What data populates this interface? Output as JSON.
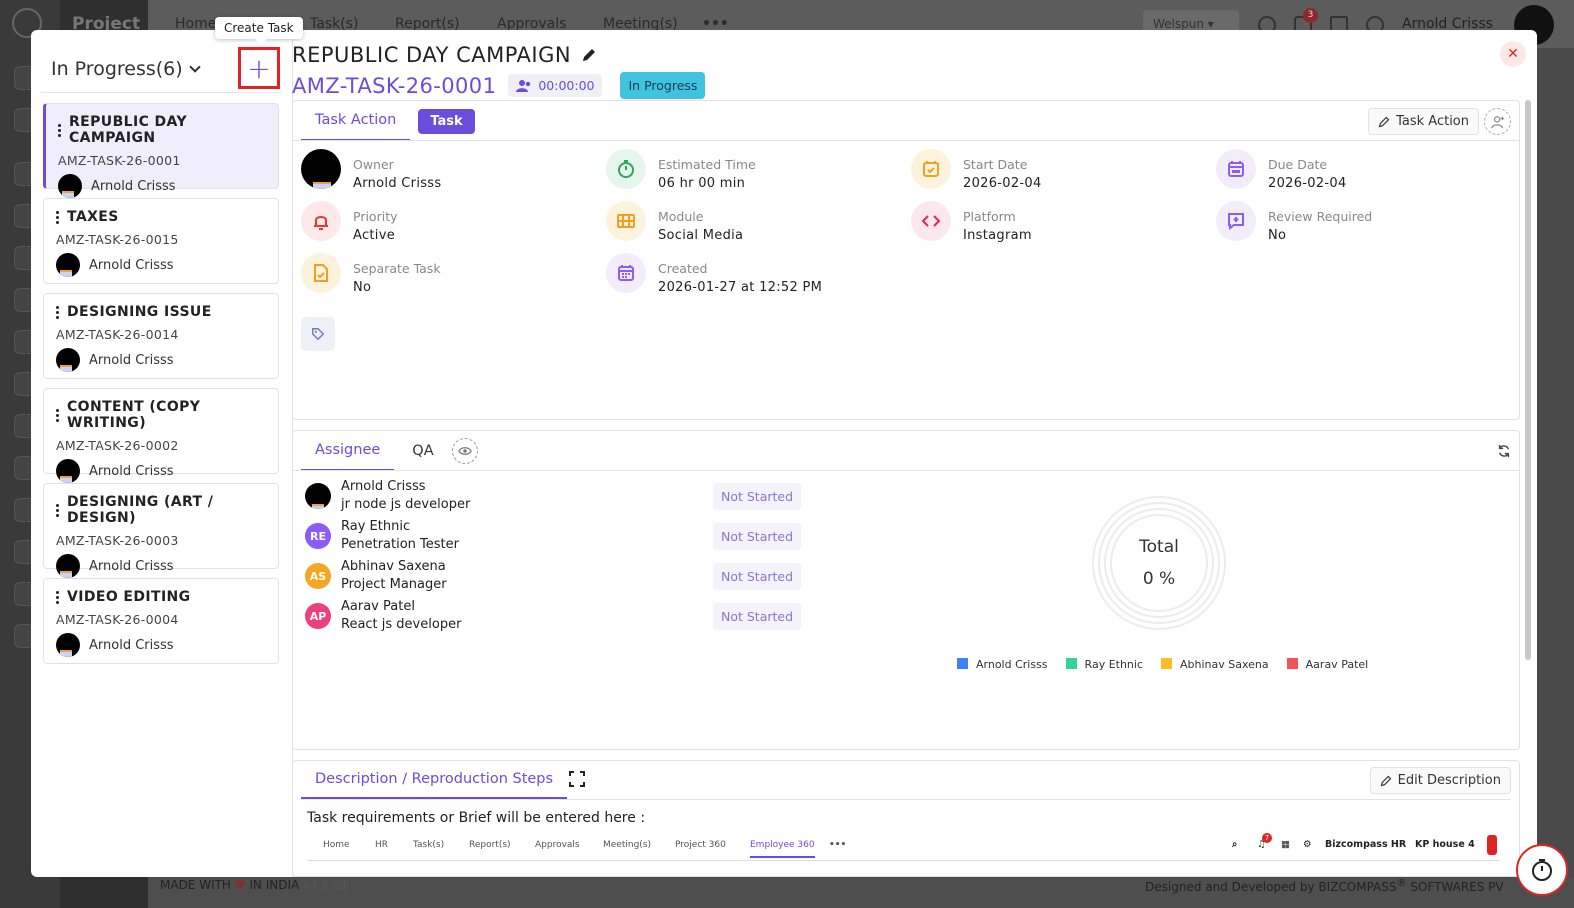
{
  "background": {
    "brand": "Project",
    "nav": [
      "Home",
      "Task(s)",
      "Report(s)",
      "Approvals",
      "Meeting(s)"
    ],
    "workspace": "Welspun",
    "notification_count": "3",
    "user_name": "Arnold Crisss",
    "footer_left": "MADE WITH",
    "footer_left2": "IN INDIA",
    "version": "v4.6.21",
    "footer_right": "Designed and Developed by",
    "footer_company": "BIZCOMPASS",
    "footer_company2": "SOFTWARES PV"
  },
  "tooltip": "Create Task",
  "left_panel": {
    "status_label": "In Progress(6)",
    "tasks": [
      {
        "title": "REPUBLIC DAY CAMPAIGN",
        "code": "AMZ-TASK-26-0001",
        "owner": "Arnold Crisss"
      },
      {
        "title": "TAXES",
        "code": "AMZ-TASK-26-0015",
        "owner": "Arnold Crisss"
      },
      {
        "title": "DESIGNING ISSUE",
        "code": "AMZ-TASK-26-0014",
        "owner": "Arnold Crisss"
      },
      {
        "title": "CONTENT (COPY WRITING)",
        "code": "AMZ-TASK-26-0002",
        "owner": "Arnold Crisss"
      },
      {
        "title": "DESIGNING (ART / DESIGN)",
        "code": "AMZ-TASK-26-0003",
        "owner": "Arnold Crisss"
      },
      {
        "title": "VIDEO EDITING",
        "code": "AMZ-TASK-26-0004",
        "owner": "Arnold Crisss"
      }
    ]
  },
  "header": {
    "task_name": "REPUBLIC DAY CAMPAIGN",
    "task_id": "AMZ-TASK-26-0001",
    "timer": "00:00:00",
    "status": "In Progress"
  },
  "details": {
    "tab_action": "Task Action",
    "tab_task": "Task",
    "action_button": "Task Action",
    "fields": {
      "owner": {
        "label": "Owner",
        "value": "Arnold Crisss"
      },
      "estimated": {
        "label": "Estimated Time",
        "value": "06 hr 00 min"
      },
      "start": {
        "label": "Start Date",
        "value": "2026-02-04"
      },
      "due": {
        "label": "Due Date",
        "value": "2026-02-04"
      },
      "priority": {
        "label": "Priority",
        "value": "Active"
      },
      "module": {
        "label": "Module",
        "value": "Social Media"
      },
      "platform": {
        "label": "Platform",
        "value": "Instagram"
      },
      "review": {
        "label": "Review Required",
        "value": "No"
      },
      "separate": {
        "label": "Separate Task",
        "value": "No"
      },
      "created": {
        "label": "Created",
        "value": "2026-01-27 at 12:52 PM"
      }
    }
  },
  "assignees": {
    "tab_assignee": "Assignee",
    "tab_qa": "QA",
    "items": [
      {
        "initials": "",
        "name": "Arnold Crisss",
        "role": "jr node js developer",
        "status": "Not Started",
        "color": "#000000"
      },
      {
        "initials": "RE",
        "name": "Ray Ethnic",
        "role": "Penetration Tester",
        "status": "Not Started",
        "color": "#8b5cf6"
      },
      {
        "initials": "AS",
        "name": "Abhinav Saxena",
        "role": "Project Manager",
        "status": "Not Started",
        "color": "#f5a623"
      },
      {
        "initials": "AP",
        "name": "Aarav Patel",
        "role": "React js developer",
        "status": "Not Started",
        "color": "#ec407a"
      }
    ],
    "total_label": "Total",
    "total_value": "0 %",
    "legend": [
      {
        "name": "Arnold Crisss",
        "color": "#3b82f6"
      },
      {
        "name": "Ray Ethnic",
        "color": "#34d399"
      },
      {
        "name": "Abhinav Saxena",
        "color": "#fbbf24"
      },
      {
        "name": "Aarav Patel",
        "color": "#f05656"
      }
    ]
  },
  "description": {
    "tab": "Description / Reproduction Steps",
    "edit_button": "Edit Description",
    "text": "Task requirements or Brief will be entered here :",
    "embedded_nav": [
      "Home",
      "HR",
      "Task(s)",
      "Report(s)",
      "Approvals",
      "Meeting(s)",
      "Project 360",
      "Employee 360"
    ],
    "embedded_right": [
      "Bizcompass HR",
      "KP house 4"
    ],
    "embedded_badge": "7"
  },
  "colors": {
    "accent": "#6c4cdc",
    "status_pill": "#40c4dd",
    "close": "#e02424"
  }
}
